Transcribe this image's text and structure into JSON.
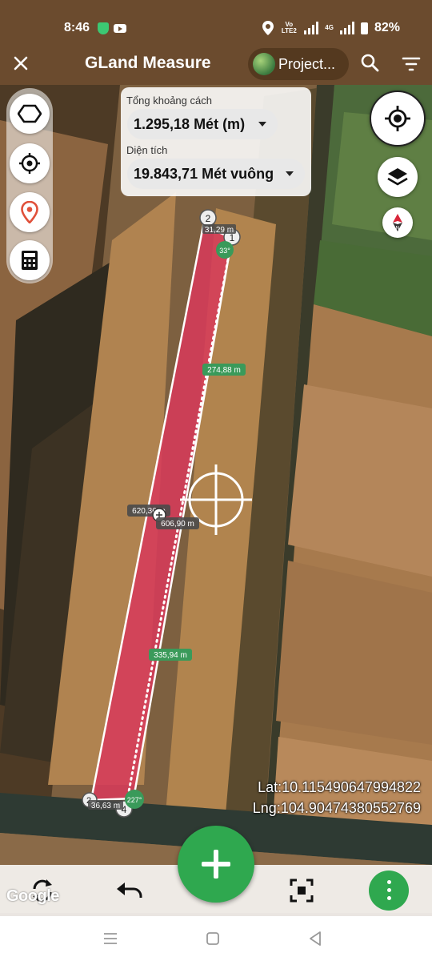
{
  "status_bar": {
    "time": "8:46",
    "network_tag": "Vo LTE2",
    "network_4g": "4G",
    "battery": "82%"
  },
  "app_bar": {
    "title": "GLand Measure",
    "project_label": "Project...",
    "icons": [
      "close-icon",
      "search-icon",
      "filter-icon"
    ]
  },
  "measure": {
    "distance_label": "Tổng khoảng cách",
    "distance_value": "1.295,18 Mét (m)",
    "area_label": "Diện tích",
    "area_value": "19.843,71 Mét vuông"
  },
  "map_labels": {
    "p1": "1",
    "p2": "2",
    "p2b": "2",
    "p4": "4",
    "seg_top": "31,29 m",
    "angle_top": "33°",
    "seg_right": "274,88 m",
    "seg_left": "620,36 m",
    "seg_mid": "606,90 m",
    "seg_lower": "335,94 m",
    "seg_bottom": "36,63 m",
    "angle_bottom": "227°"
  },
  "coords": {
    "lat": "Lat:10.115490647994822",
    "lng": "Lng:104.90474380552769"
  },
  "left_tools": [
    "polygon-icon",
    "gps-target-icon",
    "location-pin-icon",
    "calculator-icon"
  ],
  "right_tools": [
    "my-location-icon",
    "layers-icon",
    "compass-icon"
  ],
  "bottom_bar": {
    "google": "Google",
    "icons": [
      "rotate-icon",
      "undo-icon",
      "add-icon",
      "fit-bounds-icon",
      "more-icon"
    ]
  },
  "colors": {
    "header": "#6b4b2e",
    "polygon_fill": "#d83a5a",
    "accent_green": "#2fa84f"
  }
}
